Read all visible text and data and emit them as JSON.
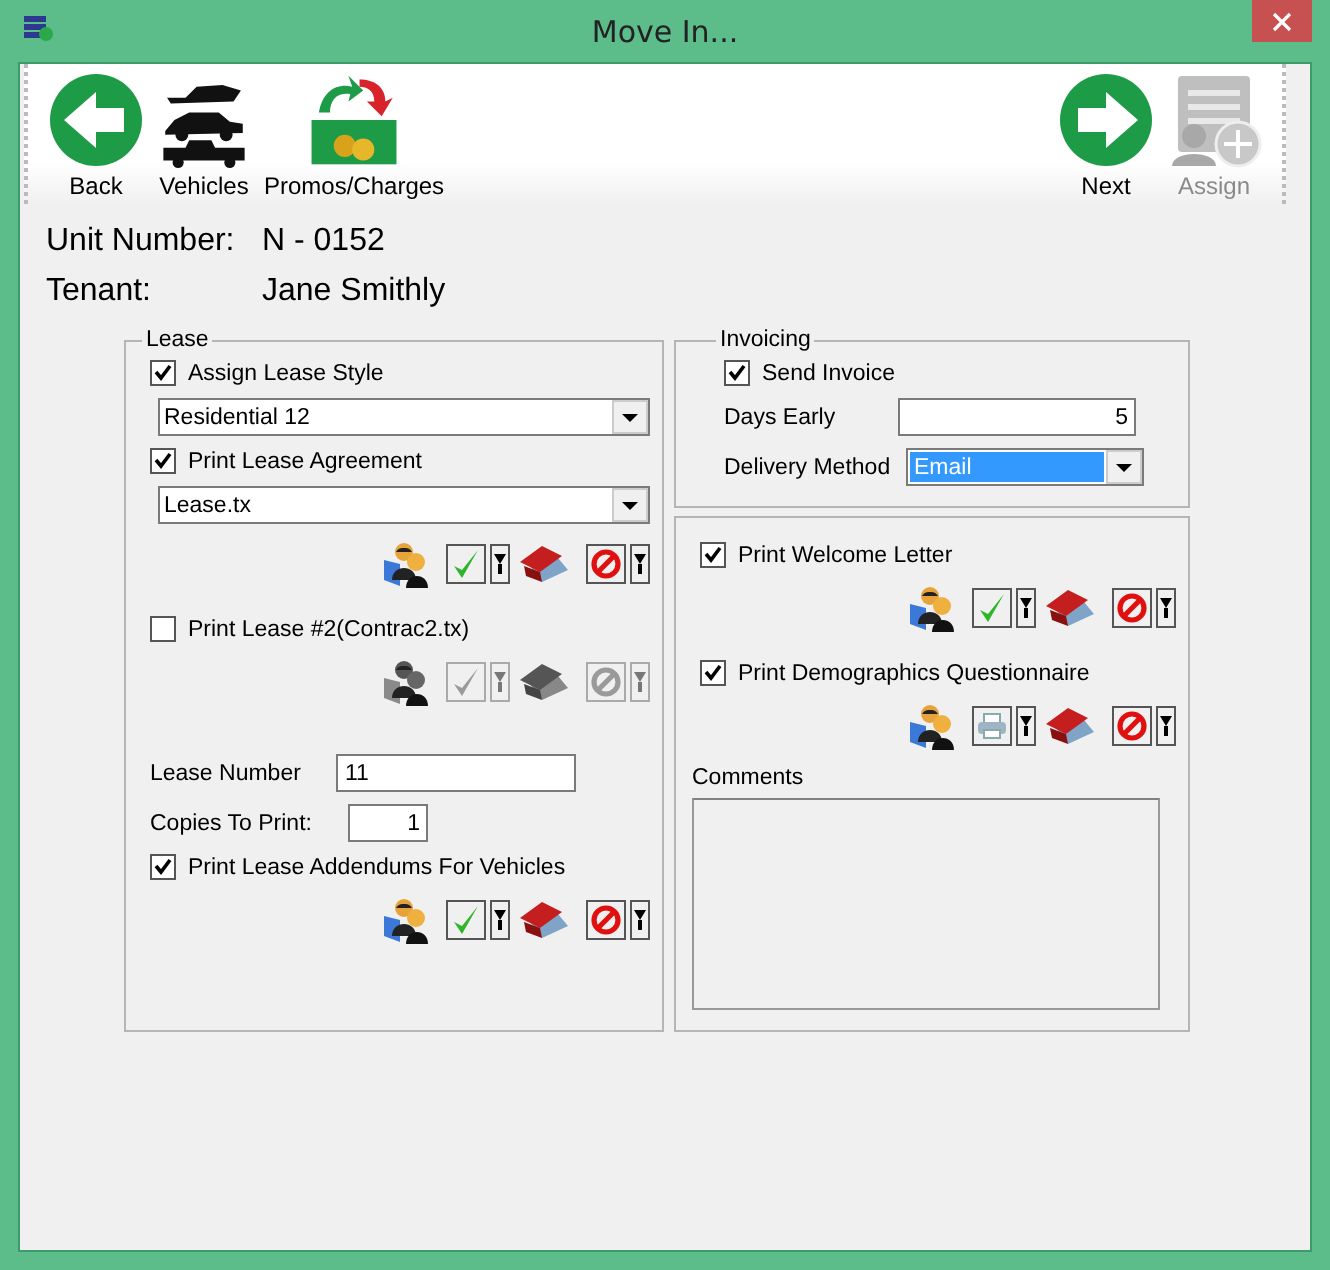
{
  "window": {
    "title": "Move In..."
  },
  "toolbar": {
    "left": [
      {
        "kind": "back",
        "label": "Back",
        "disabled": false
      },
      {
        "kind": "vehicles",
        "label": "Vehicles",
        "disabled": false
      },
      {
        "kind": "promos",
        "label": "Promos/Charges",
        "disabled": false
      }
    ],
    "right": [
      {
        "kind": "next",
        "label": "Next",
        "disabled": false
      },
      {
        "kind": "assign",
        "label": "Assign",
        "disabled": true
      }
    ]
  },
  "header": [
    {
      "label": "Unit Number:",
      "value": "N - 0152"
    },
    {
      "label": "Tenant:",
      "value": "Jane Smithly"
    }
  ],
  "columns": [
    {
      "groups": [
        {
          "title": "Lease",
          "items": [
            {
              "kind": "checkbox",
              "label": "Assign Lease Style",
              "checked": true
            },
            {
              "kind": "short-select",
              "value": "Residential 12",
              "highlighted": false
            },
            {
              "kind": "checkbox",
              "label": "Print Lease Agreement",
              "checked": true
            },
            {
              "kind": "select",
              "value": "Lease.tx",
              "highlighted": false
            },
            {
              "kind": "actions",
              "primary": {
                "kind": "check"
              },
              "disabled": false
            },
            {
              "kind": "checkbox",
              "label": "Print Lease #2(Contrac2.tx)",
              "checked": false
            },
            {
              "kind": "actions",
              "primary": {
                "kind": "check"
              },
              "disabled": true
            },
            {
              "kind": "field",
              "label": "Lease Number",
              "value": "11"
            },
            {
              "kind": "number-field",
              "label": "Copies To Print:",
              "value": "1"
            },
            {
              "kind": "checkbox",
              "label": "Print Lease Addendums For Vehicles",
              "checked": true
            },
            {
              "kind": "actions",
              "primary": {
                "kind": "check"
              },
              "disabled": false
            }
          ]
        }
      ]
    },
    {
      "groups": [
        {
          "title": "Invoicing",
          "items": [
            {
              "kind": "checkbox",
              "label": "Send Invoice",
              "checked": true
            },
            {
              "kind": "number-field",
              "label": "Days Early",
              "value": "5"
            },
            {
              "kind": "labeled-select",
              "label": "Delivery Method",
              "value": "Email",
              "highlighted": true
            }
          ]
        },
        {
          "items": [
            {
              "kind": "checkbox",
              "label": "Print Welcome Letter",
              "checked": true
            },
            {
              "kind": "actions",
              "primary": {
                "kind": "check"
              },
              "disabled": false
            },
            {
              "kind": "checkbox",
              "label": "Print Demographics Questionnaire",
              "checked": true
            },
            {
              "kind": "actions",
              "primary": {
                "kind": "print"
              },
              "disabled": false
            },
            {
              "kind": "textarea",
              "label": "Comments"
            }
          ]
        }
      ]
    }
  ]
}
